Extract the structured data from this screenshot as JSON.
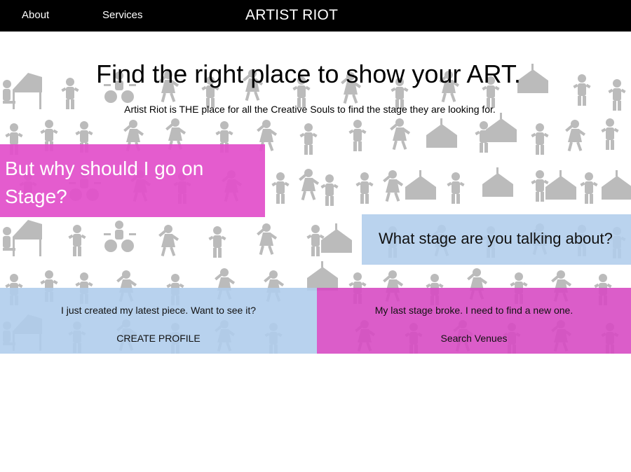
{
  "nav": {
    "about_label": "About",
    "services_label": "Services",
    "brand": "ARTIST RIOT"
  },
  "hero": {
    "headline": "Find the right place to show your ART.",
    "subline": "Artist Riot is THE place for all the Creative Souls to find the stage they are looking for.",
    "background_icon": "performers-silhouette-pattern"
  },
  "why_box": {
    "text": "But why should I go on Stage?"
  },
  "what_box": {
    "text": "What stage are you talking about?"
  },
  "cta_artist": {
    "message": "I just created my latest piece. Want to see it?",
    "action_label": "CREATE PROFILE"
  },
  "cta_venue": {
    "message": "My last stage broke. I need to find a new one.",
    "action_label": "Search Venues"
  },
  "colors": {
    "nav_bg": "#000000",
    "pink": "#e24eca",
    "light_blue": "#b0cdec",
    "silhouettes": "#b8b8b8"
  }
}
